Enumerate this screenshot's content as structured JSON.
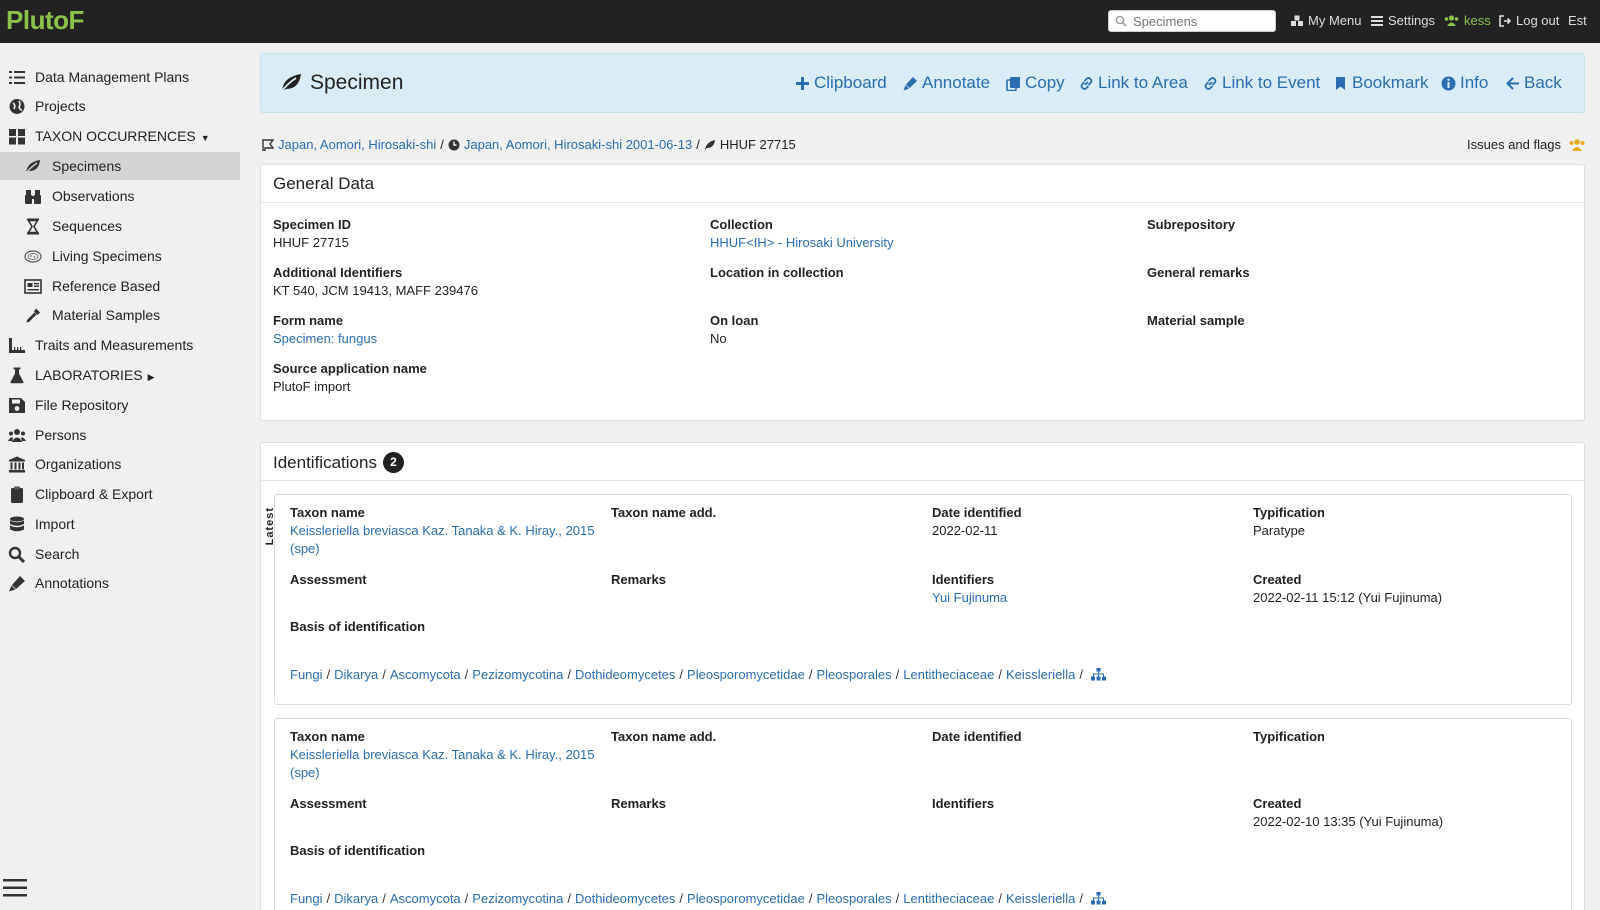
{
  "topbar": {
    "logo": "PlutoF",
    "search_placeholder": "Specimens",
    "nav": {
      "my_menu": "My Menu",
      "settings": "Settings",
      "user": "kess",
      "logout": "Log out",
      "lang": "Est"
    }
  },
  "sidebar": {
    "items": [
      {
        "label": "Data Management Plans",
        "icon": "list-check-icon"
      },
      {
        "label": "Projects",
        "icon": "globe-icon"
      },
      {
        "label": "TAXON OCCURRENCES",
        "icon": "grid-icon"
      },
      {
        "label": "Specimens",
        "icon": "leaf-icon"
      },
      {
        "label": "Observations",
        "icon": "binoculars-icon"
      },
      {
        "label": "Sequences",
        "icon": "hourglass-icon"
      },
      {
        "label": "Living Specimens",
        "icon": "petri-dish-icon"
      },
      {
        "label": "Reference Based",
        "icon": "newspaper-icon"
      },
      {
        "label": "Material Samples",
        "icon": "eyedropper-icon"
      },
      {
        "label": "Traits and Measurements",
        "icon": "ruler-icon"
      },
      {
        "label": "LABORATORIES",
        "icon": "flask-icon"
      },
      {
        "label": "File Repository",
        "icon": "floppy-icon"
      },
      {
        "label": "Persons",
        "icon": "users-icon"
      },
      {
        "label": "Organizations",
        "icon": "institution-icon"
      },
      {
        "label": "Clipboard & Export",
        "icon": "clipboard-icon"
      },
      {
        "label": "Import",
        "icon": "database-icon"
      },
      {
        "label": "Search",
        "icon": "search-icon"
      },
      {
        "label": "Annotations",
        "icon": "pen-icon"
      }
    ]
  },
  "header": {
    "title": "Specimen",
    "buttons": {
      "clipboard": "Clipboard",
      "annotate": "Annotate",
      "copy": "Copy",
      "link_area": "Link to Area",
      "link_event": "Link to Event",
      "bookmark": "Bookmark",
      "info": "Info",
      "back": "Back"
    }
  },
  "breadcrumb": {
    "area": "Japan, Aomori, Hirosaki-shi",
    "event": "Japan, Aomori, Hirosaki-shi 2001-06-13",
    "specimen": "HHUF 27715",
    "sep": "/"
  },
  "issues_flags": "Issues and flags",
  "general": {
    "title": "General Data",
    "specimen_id": {
      "label": "Specimen ID",
      "value": "HHUF 27715"
    },
    "collection": {
      "label": "Collection",
      "value": "HHUF<IH> - Hirosaki University"
    },
    "subrepository": {
      "label": "Subrepository"
    },
    "additional_ids": {
      "label": "Additional Identifiers",
      "value": "KT 540, JCM 19413, MAFF 239476"
    },
    "location": {
      "label": "Location in collection"
    },
    "general_remarks": {
      "label": "General remarks"
    },
    "form_name": {
      "label": "Form name",
      "value": "Specimen: fungus"
    },
    "on_loan": {
      "label": "On loan",
      "value": "No"
    },
    "material_sample": {
      "label": "Material sample"
    },
    "source_app": {
      "label": "Source application name",
      "value": "PlutoF import"
    }
  },
  "identifications": {
    "title": "Identifications",
    "count": "2",
    "latest_tag": "Latest",
    "labels": {
      "taxon_name": "Taxon name",
      "taxon_add": "Taxon name add.",
      "date": "Date identified",
      "typification": "Typification",
      "assessment": "Assessment",
      "remarks": "Remarks",
      "identifiers": "Identifiers",
      "created": "Created",
      "basis": "Basis of identification"
    },
    "items": [
      {
        "taxon_line1": "Keissleriella breviasca Kaz. Tanaka & K. Hiray., 2015",
        "taxon_line2": "(spe)",
        "date": "2022-02-11",
        "typification": "Paratype",
        "identifiers": "Yui Fujinuma",
        "created": "2022-02-11 15:12 (Yui Fujinuma)"
      },
      {
        "taxon_line1": "Keissleriella breviasca Kaz. Tanaka & K. Hiray., 2015",
        "taxon_line2": "(spe)",
        "date": "",
        "typification": "",
        "identifiers": "",
        "created": "2022-02-10 13:35 (Yui Fujinuma)"
      }
    ],
    "lineage": [
      "Fungi",
      "Dikarya",
      "Ascomycota",
      "Pezizomycotina",
      "Dothideomycetes",
      "Pleosporomycetidae",
      "Pleosporales",
      "Lentitheciaceae",
      "Keissleriella"
    ]
  }
}
